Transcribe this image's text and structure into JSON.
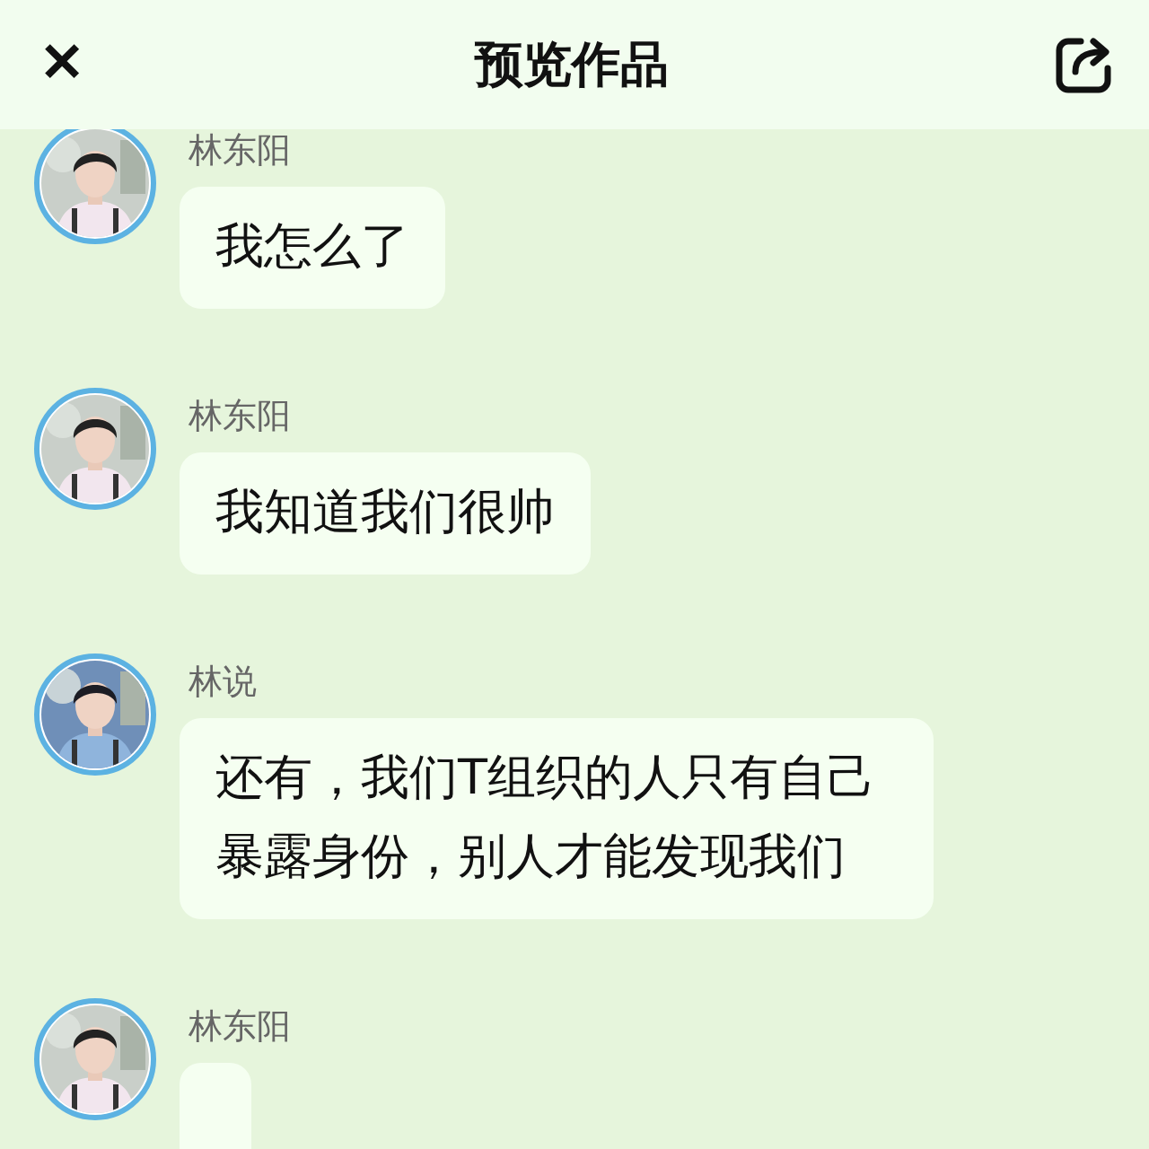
{
  "header": {
    "close_icon": "✕",
    "title": "预览作品"
  },
  "messages": [
    {
      "name": "林东阳",
      "text": "我怎么了"
    },
    {
      "name": "林东阳",
      "text": "我知道我们很帅"
    },
    {
      "name": "林说",
      "text": "还有，我们T组织的人只有自己暴露身份，别人才能发现我们"
    },
    {
      "name": "林东阳"
    }
  ]
}
